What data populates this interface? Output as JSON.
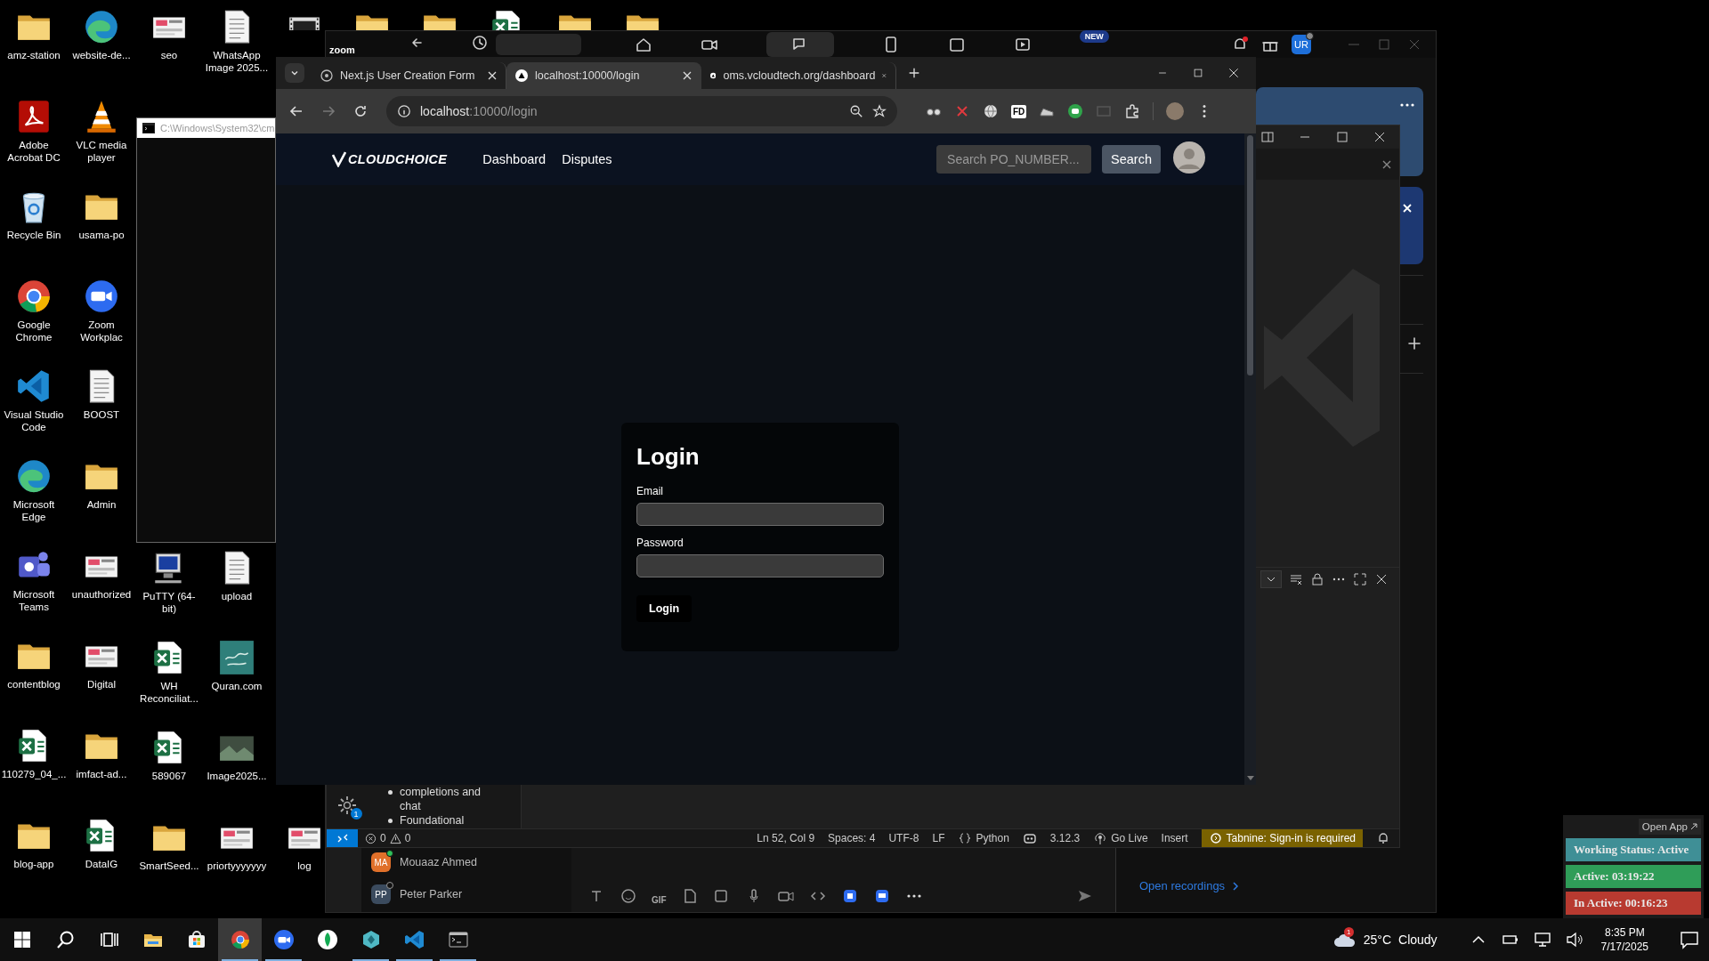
{
  "desktop": {
    "columns": [
      {
        "top": [
          {
            "label": "amz-station",
            "kind": "folder"
          },
          {
            "label": "Adobe Acrobat DC",
            "kind": "pdf"
          },
          {
            "label": "Recycle Bin",
            "kind": "recycle"
          },
          {
            "label": "Google Chrome",
            "kind": "browser"
          },
          {
            "label": "Visual Studio Code",
            "kind": "editor"
          },
          {
            "label": "Microsoft Edge",
            "kind": "wave"
          },
          {
            "label": "Microsoft Teams",
            "kind": "chat"
          },
          {
            "label": "contentblog",
            "kind": "folder"
          },
          {
            "label": "110279_04_...",
            "kind": "sheet"
          },
          {
            "label": "blog-app",
            "kind": "folder"
          }
        ]
      },
      {
        "top": [
          {
            "label": "website-de...",
            "kind": "wave"
          },
          {
            "label": "VLC media player",
            "kind": "cone"
          },
          {
            "label": "usama-po",
            "kind": "folder"
          },
          {
            "label": "Zoom Workplac",
            "kind": "camera"
          },
          {
            "label": "BOOST",
            "kind": "document"
          },
          {
            "label": "Admin",
            "kind": "folder"
          },
          {
            "label": "unauthorized",
            "kind": "image"
          },
          {
            "label": "Digital",
            "kind": "image"
          },
          {
            "label": "imfact-ad...",
            "kind": "folder"
          },
          {
            "label": "DataIG",
            "kind": "sheet"
          }
        ]
      },
      {
        "top": [
          {
            "label": "seo",
            "kind": "image"
          }
        ],
        "bottom": [
          {
            "label": "PuTTY (64-bit)",
            "kind": "computer"
          },
          {
            "label": "WH Reconciliat...",
            "kind": "sheet"
          },
          {
            "label": "589067",
            "kind": "sheet"
          },
          {
            "label": "SmartSeed...",
            "kind": "folder"
          }
        ]
      },
      {
        "top": [
          {
            "label": "WhatsApp Image 2025...",
            "kind": "document"
          }
        ],
        "bottom": [
          {
            "label": "upload",
            "kind": "document"
          },
          {
            "label": "Quran.com",
            "kind": "tile"
          },
          {
            "label": "Image2025...",
            "kind": "photo"
          },
          {
            "label": "priortyyyyyyy",
            "kind": "image"
          }
        ]
      },
      {
        "top": [
          {
            "kind": "film"
          }
        ],
        "bottom": [
          {
            "label": "log",
            "kind": "image"
          }
        ]
      },
      {
        "top": [
          {
            "kind": "folder"
          }
        ]
      },
      {
        "top": [
          {
            "kind": "folder"
          }
        ]
      },
      {
        "top": [
          {
            "kind": "sheet"
          }
        ]
      },
      {
        "top": [
          {
            "kind": "folder"
          }
        ]
      },
      {
        "top": [
          {
            "kind": "folder"
          }
        ]
      }
    ]
  },
  "console": {
    "title": "C:\\Windows\\System32\\cm"
  },
  "meeting_app": {
    "title": "zoom",
    "badge": "NEW",
    "avatar": "UR",
    "contacts": [
      {
        "initials": "MA",
        "name": "Mouaaz Ahmed",
        "color": "#e0702a",
        "online": true
      },
      {
        "initials": "PP",
        "name": "Peter Parker",
        "color": "#3b4b5e",
        "online": false
      }
    ],
    "composer": {
      "gif": "GIF"
    },
    "recordings_link": "Open recordings"
  },
  "editor": {
    "settings_badge": "1",
    "side_list": [
      "completions and chat",
      "Foundational"
    ],
    "status_bar": {
      "errors": "0",
      "warnings": "0",
      "items": [
        {
          "kind": "text",
          "text": "Ln 52, Col 9"
        },
        {
          "kind": "text",
          "text": "Spaces: 4"
        },
        {
          "kind": "text",
          "text": "UTF-8"
        },
        {
          "kind": "text",
          "text": "LF"
        },
        {
          "kind": "language",
          "text": "Python"
        },
        {
          "kind": "assistant"
        },
        {
          "kind": "text",
          "text": "3.12.3"
        },
        {
          "kind": "live",
          "text": "Go Live"
        },
        {
          "kind": "text",
          "text": "Insert"
        },
        {
          "kind": "warning",
          "text": "Tabnine: Sign-in is required"
        },
        {
          "kind": "bell"
        }
      ]
    }
  },
  "browser": {
    "tabs": [
      {
        "title": "Next.js User Creation Form",
        "kind": "globe",
        "selected": false
      },
      {
        "title": "localhost:10000/login",
        "kind": "triangle",
        "selected": true
      },
      {
        "title": "oms.vcloudtech.org/dashboard",
        "kind": "triangle",
        "selected": false
      }
    ],
    "address": {
      "host": "localhost",
      "path": ":10000/login"
    },
    "extensions": [
      {
        "kind": "glasses"
      },
      {
        "kind": "cross"
      },
      {
        "kind": "globe"
      },
      {
        "kind": "label",
        "text": "FD"
      },
      {
        "kind": "shoe"
      },
      {
        "kind": "robot"
      },
      {
        "kind": "screen"
      }
    ],
    "page": {
      "logo": "CLOUDCHOICE",
      "nav_links": [
        "Dashboard",
        "Disputes"
      ],
      "search": {
        "placeholder": "Search PO_NUMBER..."
      },
      "search_button": "Search",
      "login": {
        "title": "Login",
        "fields": [
          {
            "label": "Email"
          },
          {
            "label": "Password"
          }
        ],
        "button": "Login"
      }
    }
  },
  "status_widget": {
    "open_app": "Open App",
    "rows": [
      {
        "text": "Working Status: Active",
        "color": "#3f8f96"
      },
      {
        "text": "Active: 03:19:22",
        "color": "#2f9d58"
      },
      {
        "text": "In Active: 00:16:23",
        "color": "#b83a30"
      }
    ]
  },
  "taskbar": {
    "apps": [
      {
        "kind": "explorer",
        "active": false,
        "running": false
      },
      {
        "kind": "store",
        "active": false,
        "running": false
      },
      {
        "kind": "browser",
        "active": true,
        "running": true
      },
      {
        "kind": "camera",
        "active": false,
        "running": true
      },
      {
        "kind": "leaf",
        "active": false,
        "running": false
      },
      {
        "kind": "gem",
        "active": false,
        "running": true
      },
      {
        "kind": "editor",
        "active": false,
        "running": true
      },
      {
        "kind": "terminal",
        "active": false,
        "running": true
      }
    ],
    "weather": {
      "temperature": "25°C",
      "condition": "Cloudy",
      "badge": "1"
    },
    "clock": {
      "time": "8:35 PM",
      "date": "7/17/2025"
    }
  }
}
